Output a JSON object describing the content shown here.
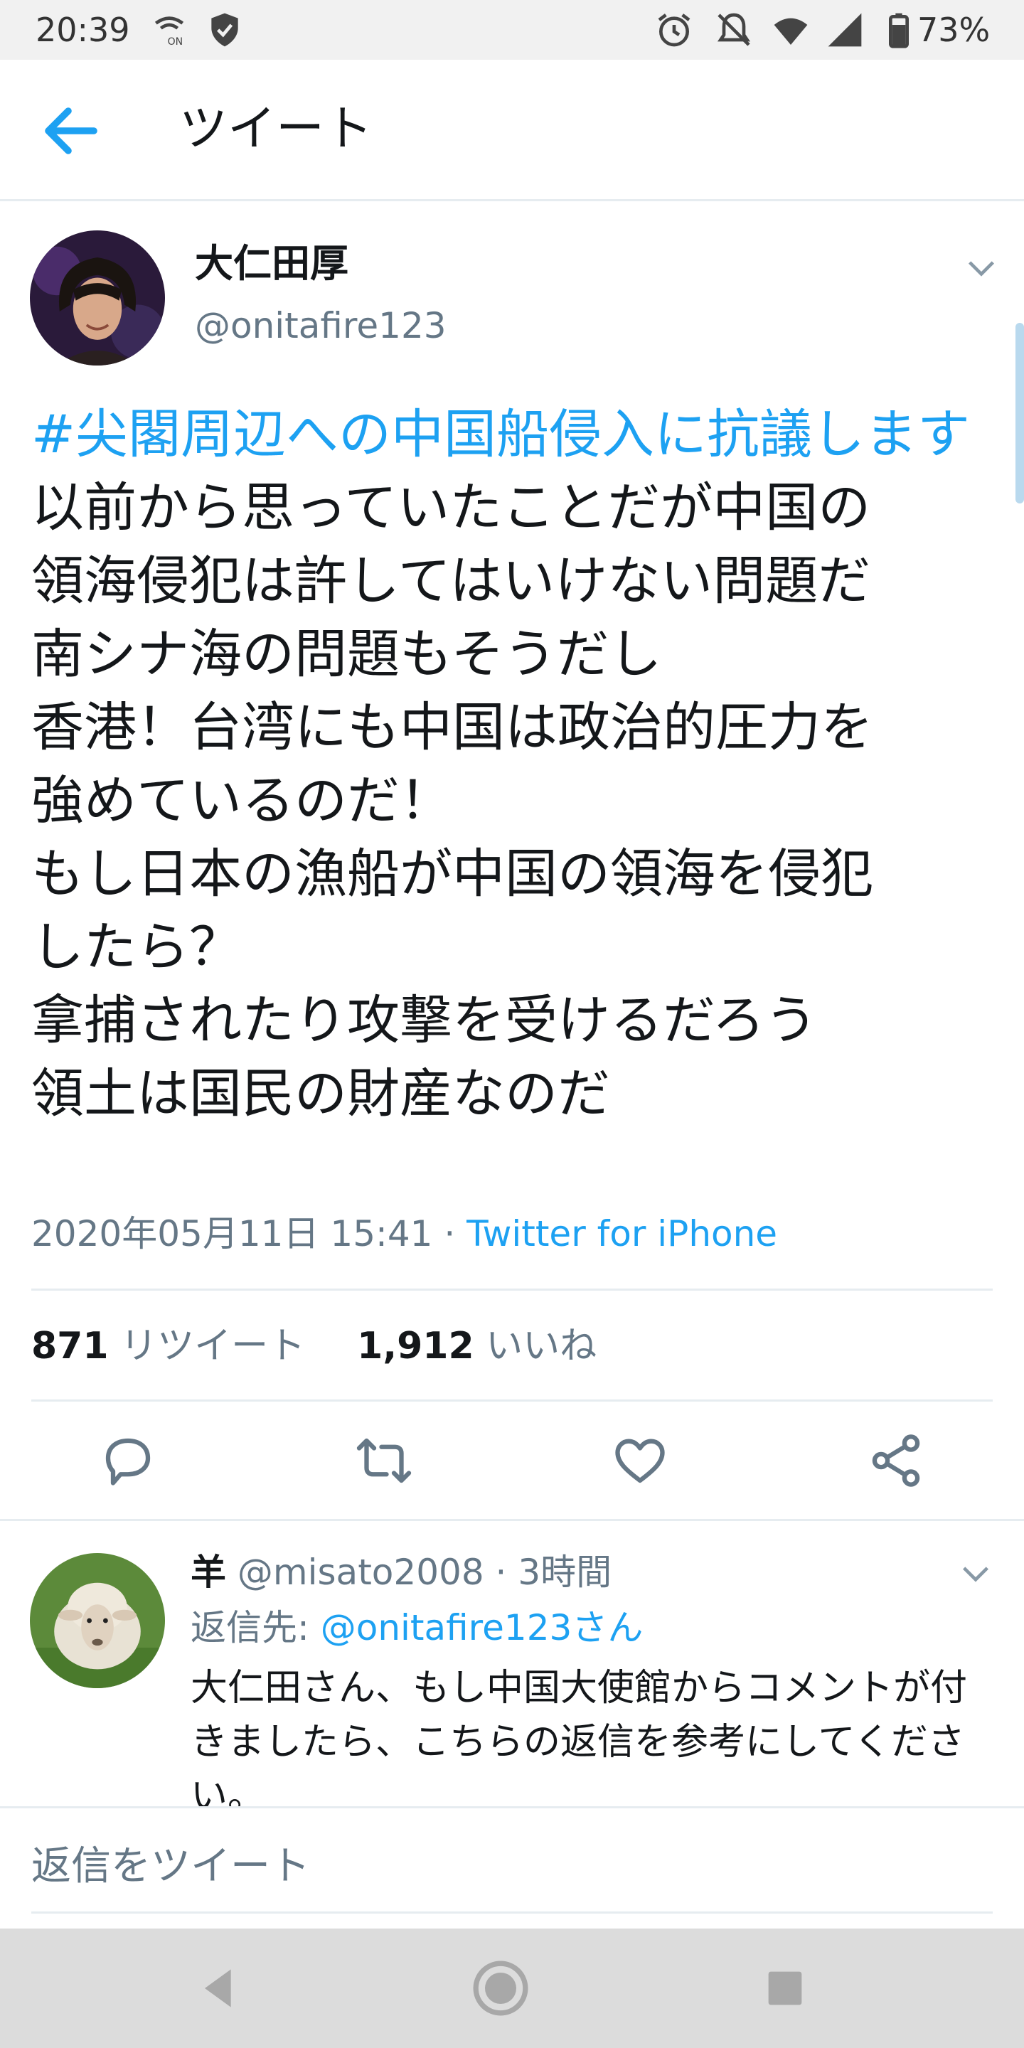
{
  "status_bar": {
    "time": "20:39",
    "battery": "73%",
    "icons": [
      "wifi-calling-icon",
      "shield-icon",
      "alarm-icon",
      "mute-icon",
      "wifi-icon",
      "signal-icon",
      "battery-icon"
    ]
  },
  "header": {
    "title": "ツイート",
    "back_icon": "back-arrow-icon"
  },
  "tweet": {
    "display_name": "大仁田厚",
    "handle": "@onitafire123",
    "hashtag": "#尖閣周辺への中国船侵入に抗議します",
    "body": "以前から思っていたことだが中国の\n領海侵犯は許してはいけない問題だ\n南シナ海の問題もそうだし\n香港！台湾にも中国は政治的圧力を\n強めているのだ！\nもし日本の漁船が中国の領海を侵犯\nしたら？\n拿捕されたり攻撃を受けるだろう\n領土は国民の財産なのだ",
    "timestamp": "2020年05月11日 15:41",
    "separator": " · ",
    "source": "Twitter for iPhone",
    "retweet_count": "871",
    "retweet_label": "リツイート",
    "like_count": "1,912",
    "like_label": "いいね",
    "actions": [
      "reply-icon",
      "retweet-icon",
      "like-icon",
      "share-icon"
    ]
  },
  "reply": {
    "name": "羊",
    "handle": "@misato2008",
    "separator": " · ",
    "time": "3時間",
    "reply_to_label": "返信先: ",
    "reply_to_handle": "@onitafire123さん",
    "text": "大仁田さん、もし中国大使館からコメントが付きましたら、こちらの返信を参考にしてください。"
  },
  "compose": {
    "placeholder": "返信をツイート"
  },
  "colors": {
    "accent": "#1da1f2",
    "secondary_text": "#657786",
    "divider": "#e6ecf0"
  }
}
